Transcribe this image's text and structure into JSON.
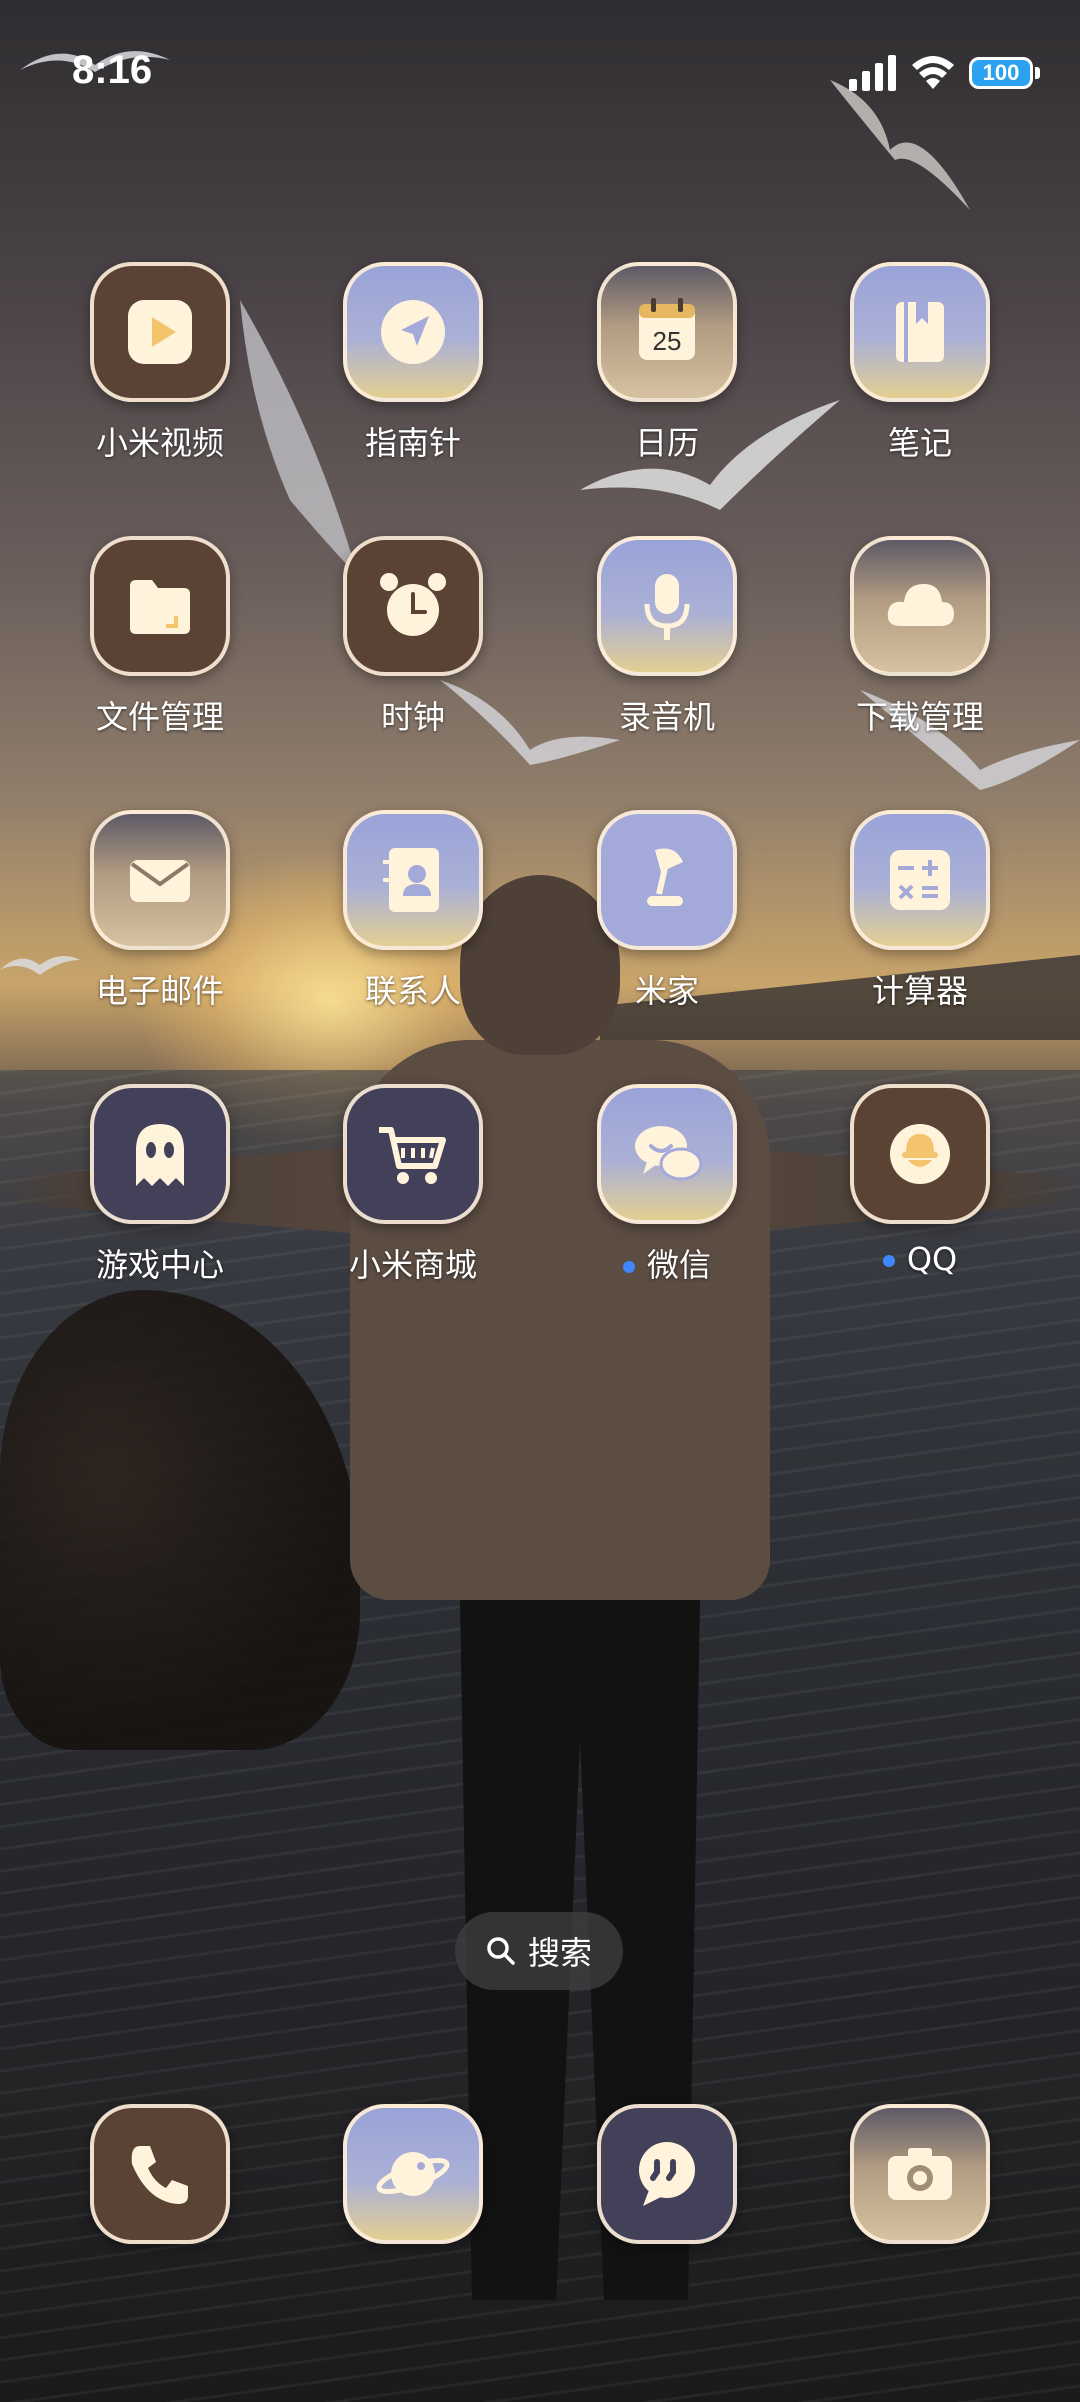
{
  "status_bar": {
    "time": "8:16",
    "battery_level": "100",
    "icons": [
      "signal-icon",
      "wifi-icon",
      "battery-icon"
    ]
  },
  "apps": {
    "row1": [
      {
        "label": "小米视频",
        "icon": "video-play-icon"
      },
      {
        "label": "指南针",
        "icon": "compass-arrow-icon"
      },
      {
        "label": "日历",
        "icon": "calendar-icon",
        "date": "25"
      },
      {
        "label": "笔记",
        "icon": "notebook-icon"
      }
    ],
    "row2": [
      {
        "label": "文件管理",
        "icon": "folder-icon"
      },
      {
        "label": "时钟",
        "icon": "alarm-clock-icon"
      },
      {
        "label": "录音机",
        "icon": "microphone-icon"
      },
      {
        "label": "下载管理",
        "icon": "cloud-icon"
      }
    ],
    "row3": [
      {
        "label": "电子邮件",
        "icon": "envelope-icon"
      },
      {
        "label": "联系人",
        "icon": "contact-book-icon"
      },
      {
        "label": "米家",
        "icon": "desk-lamp-icon"
      },
      {
        "label": "计算器",
        "icon": "calculator-icon"
      }
    ],
    "row4": [
      {
        "label": "游戏中心",
        "icon": "ghost-icon"
      },
      {
        "label": "小米商城",
        "icon": "shopping-cart-icon"
      },
      {
        "label": "微信",
        "icon": "chat-bubbles-icon",
        "new_indicator": true
      },
      {
        "label": "QQ",
        "icon": "qq-penguin-icon",
        "new_indicator": true
      }
    ]
  },
  "search": {
    "label": "搜索"
  },
  "dock": [
    {
      "icon": "phone-icon"
    },
    {
      "icon": "browser-planet-icon"
    },
    {
      "icon": "messages-icon"
    },
    {
      "icon": "camera-icon"
    }
  ],
  "colors": {
    "icon_brown": "#5a4234",
    "icon_lavender": "#a3a9d9",
    "icon_navy": "#43405a",
    "icon_cream": "#fff3dc",
    "badge_dot": "#3f86ff",
    "battery": "#2ba2f0"
  }
}
